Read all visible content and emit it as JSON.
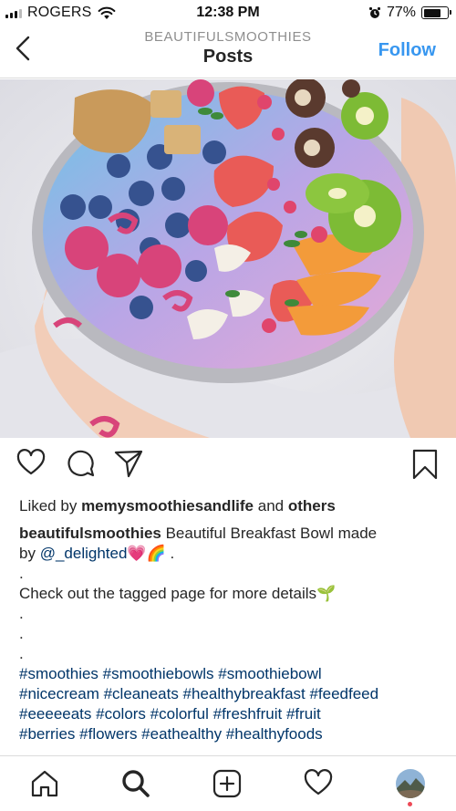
{
  "status_bar": {
    "carrier": "ROGERS",
    "time": "12:38 PM",
    "battery_percent": "77%",
    "battery_level": 0.77,
    "icons": [
      "signal-icon",
      "wifi-icon",
      "alarm-icon",
      "battery-icon"
    ]
  },
  "header": {
    "username": "BEAUTIFULSMOOTHIES",
    "title": "Posts",
    "follow_label": "Follow",
    "back_icon": "chevron-left-icon"
  },
  "post": {
    "actions": [
      "heart-icon",
      "comment-icon",
      "share-icon",
      "bookmark-icon"
    ],
    "liked_by_prefix": "Liked by",
    "liked_by_user": "memysmoothiesandlife",
    "liked_by_and": "and",
    "liked_by_others": "others",
    "author": "beautifulsmoothies",
    "caption_text_1": "Beautiful Breakfast Bowl made",
    "caption_by": "by",
    "caption_mention": "@_delighted",
    "caption_emoji": "💗🌈 .",
    "dot": ".",
    "tagged_line": "Check out the tagged page for more details🌱",
    "hashtag_lines": [
      "#smoothies #smoothiebowls #smoothiebowl",
      "#nicecream #cleaneats #healthybreakfast #feedfeed",
      "#eeeeeats #colors #colorful #freshfruit #fruit",
      "#berries #flowers #eathealthy #healthyfoods"
    ]
  },
  "bottom_nav": {
    "items": [
      "home-icon",
      "search-icon",
      "new-post-icon",
      "activity-icon",
      "profile-avatar"
    ]
  },
  "colors": {
    "accent": "#3897f0",
    "link": "#003569",
    "text": "#262626",
    "muted": "#8e8e8e",
    "divider": "#dbdbdb"
  }
}
